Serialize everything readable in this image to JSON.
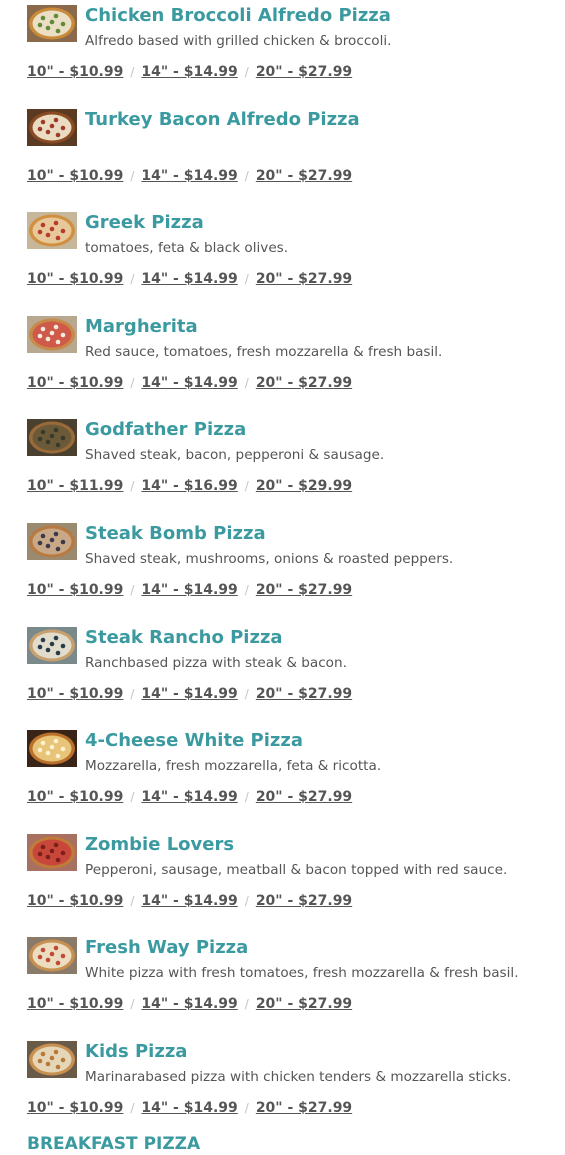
{
  "menu": {
    "items": [
      {
        "name": "Chicken Broccoli Alfredo Pizza",
        "description": "Alfredo based with grilled chicken & broccoli.",
        "thumb_colors": {
          "crust": "#c98a3a",
          "top": "#eadfc4",
          "accent": "#5f8a3a",
          "bg": "#8a6a4a"
        },
        "prices": [
          {
            "label": "10\" - $10.99"
          },
          {
            "label": "14\" - $14.99"
          },
          {
            "label": "20\" - $27.99"
          }
        ]
      },
      {
        "name": "Turkey Bacon Alfredo Pizza",
        "description": "",
        "thumb_colors": {
          "crust": "#8a4a22",
          "top": "#e9dcc2",
          "accent": "#a03a28",
          "bg": "#5a3a22"
        },
        "prices": [
          {
            "label": "10\" - $10.99"
          },
          {
            "label": "14\" - $14.99"
          },
          {
            "label": "20\" - $27.99"
          }
        ]
      },
      {
        "name": "Greek Pizza",
        "description": "tomatoes, feta & black olives.",
        "thumb_colors": {
          "crust": "#d09040",
          "top": "#e6c89a",
          "accent": "#b83a2a",
          "bg": "#c7b79a"
        },
        "prices": [
          {
            "label": "10\" - $10.99"
          },
          {
            "label": "14\" - $14.99"
          },
          {
            "label": "20\" - $27.99"
          }
        ]
      },
      {
        "name": "Margherita",
        "description": "Red sauce, tomatoes, fresh mozzarella & fresh basil.",
        "thumb_colors": {
          "crust": "#c88a48",
          "top": "#d05a4a",
          "accent": "#f2ece0",
          "bg": "#b8a890"
        },
        "prices": [
          {
            "label": "10\" - $10.99"
          },
          {
            "label": "14\" - $14.99"
          },
          {
            "label": "20\" - $27.99"
          }
        ]
      },
      {
        "name": "Godfather Pizza",
        "description": "Shaved steak, bacon, pepperoni & sausage.",
        "thumb_colors": {
          "crust": "#9a6a38",
          "top": "#6a5a3a",
          "accent": "#3a3a2a",
          "bg": "#4a4030"
        },
        "prices": [
          {
            "label": "10\" - $11.99"
          },
          {
            "label": "14\" - $16.99"
          },
          {
            "label": "20\" - $29.99"
          }
        ]
      },
      {
        "name": "Steak Bomb Pizza",
        "description": "Shaved steak, mushrooms, onions & roasted peppers.",
        "thumb_colors": {
          "crust": "#b87a40",
          "top": "#c9a888",
          "accent": "#3a3a4a",
          "bg": "#9a8a70"
        },
        "prices": [
          {
            "label": "10\" - $10.99"
          },
          {
            "label": "14\" - $14.99"
          },
          {
            "label": "20\" - $27.99"
          }
        ]
      },
      {
        "name": "Steak Rancho Pizza",
        "description": "Ranchbased pizza with steak & bacon.",
        "thumb_colors": {
          "crust": "#c8a070",
          "top": "#e2dccc",
          "accent": "#2a3a4a",
          "bg": "#7a8a8a"
        },
        "prices": [
          {
            "label": "10\" - $10.99"
          },
          {
            "label": "14\" - $14.99"
          },
          {
            "label": "20\" - $27.99"
          }
        ]
      },
      {
        "name": "4-Cheese White Pizza",
        "description": "Mozzarella, fresh mozzarella, feta & ricotta.",
        "thumb_colors": {
          "crust": "#b8702a",
          "top": "#e8c478",
          "accent": "#fff2d0",
          "bg": "#3a2418"
        },
        "prices": [
          {
            "label": "10\" - $10.99"
          },
          {
            "label": "14\" - $14.99"
          },
          {
            "label": "20\" - $27.99"
          }
        ]
      },
      {
        "name": "Zombie Lovers",
        "description": "Pepperoni, sausage, meatball & bacon topped with red sauce.",
        "thumb_colors": {
          "crust": "#c07a3a",
          "top": "#c8463a",
          "accent": "#7a2018",
          "bg": "#a87060"
        },
        "prices": [
          {
            "label": "10\" - $10.99"
          },
          {
            "label": "14\" - $14.99"
          },
          {
            "label": "20\" - $27.99"
          }
        ]
      },
      {
        "name": "Fresh Way Pizza",
        "description": "White pizza with fresh tomatoes, fresh mozzarella & fresh basil.",
        "thumb_colors": {
          "crust": "#c89050",
          "top": "#ecdcc0",
          "accent": "#c04a38",
          "bg": "#8a7a6a"
        },
        "prices": [
          {
            "label": "10\" - $10.99"
          },
          {
            "label": "14\" - $14.99"
          },
          {
            "label": "20\" - $27.99"
          }
        ]
      },
      {
        "name": "Kids Pizza",
        "description": "Marinarabased pizza with chicken tenders & mozzarella sticks.",
        "thumb_colors": {
          "crust": "#c89050",
          "top": "#e6d6b8",
          "accent": "#b87838",
          "bg": "#6a5a48"
        },
        "prices": [
          {
            "label": "10\" - $10.99"
          },
          {
            "label": "14\" - $14.99"
          },
          {
            "label": "20\" - $27.99"
          }
        ]
      }
    ],
    "separator": "/",
    "next_section_title": "BREAKFAST PIZZA"
  },
  "theme": {
    "accent": "#3a9aa0",
    "text": "#555555",
    "separator": "#c4c4c4"
  }
}
